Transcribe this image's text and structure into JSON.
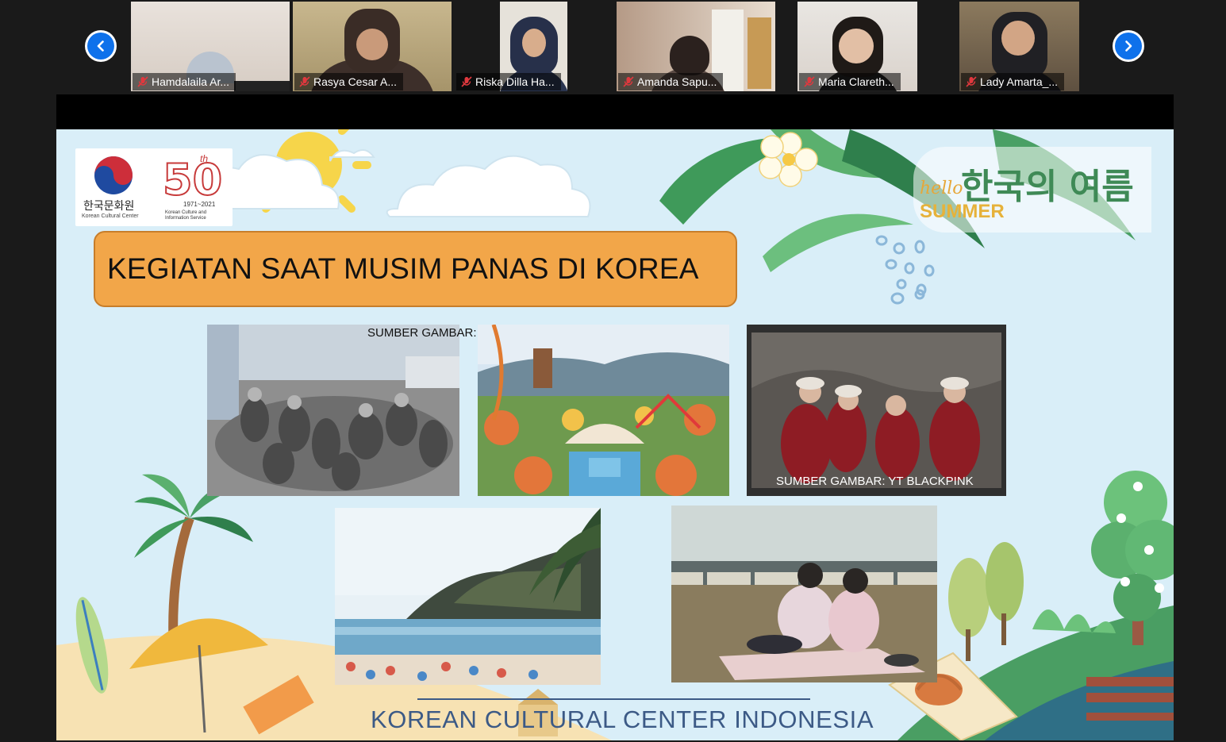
{
  "participants": [
    {
      "name": "Hamdalaila Ar...",
      "muted": true
    },
    {
      "name": "Rasya Cesar A...",
      "muted": true
    },
    {
      "name": "Riska Dilla Ha...",
      "muted": true
    },
    {
      "name": "Amanda Sapu...",
      "muted": true
    },
    {
      "name": "Maria Clareth...",
      "muted": true
    },
    {
      "name": "Lady Amarta_...",
      "muted": true
    }
  ],
  "nav": {
    "prev_icon": "chevron-left-icon",
    "next_icon": "chevron-right-icon"
  },
  "slide": {
    "logo": {
      "org_kr": "한국문화원",
      "org_en": "Korean Cultural Center",
      "anniv_suffix": "th",
      "years": "1971~2021",
      "kcis": "Korean Culture and Information Service"
    },
    "badge": {
      "hello": "hello",
      "korean": "한국의 여름",
      "summer": "SUMMER"
    },
    "title": "KEGIATAN SAAT MUSIM PANAS DI KOREA",
    "captions": {
      "source_visitkorea": "SUMBER GAMBAR: VISITKOREA.COM",
      "source_blackpink": "SUMBER GAMBAR: YT BLACKPINK"
    },
    "footer": "KOREAN CULTURAL CENTER INDONESIA"
  },
  "colors": {
    "accent_blue": "#0e71eb",
    "title_orange": "#f2a649",
    "slide_bg": "#d9eef8",
    "footer_text": "#3c5a86"
  }
}
